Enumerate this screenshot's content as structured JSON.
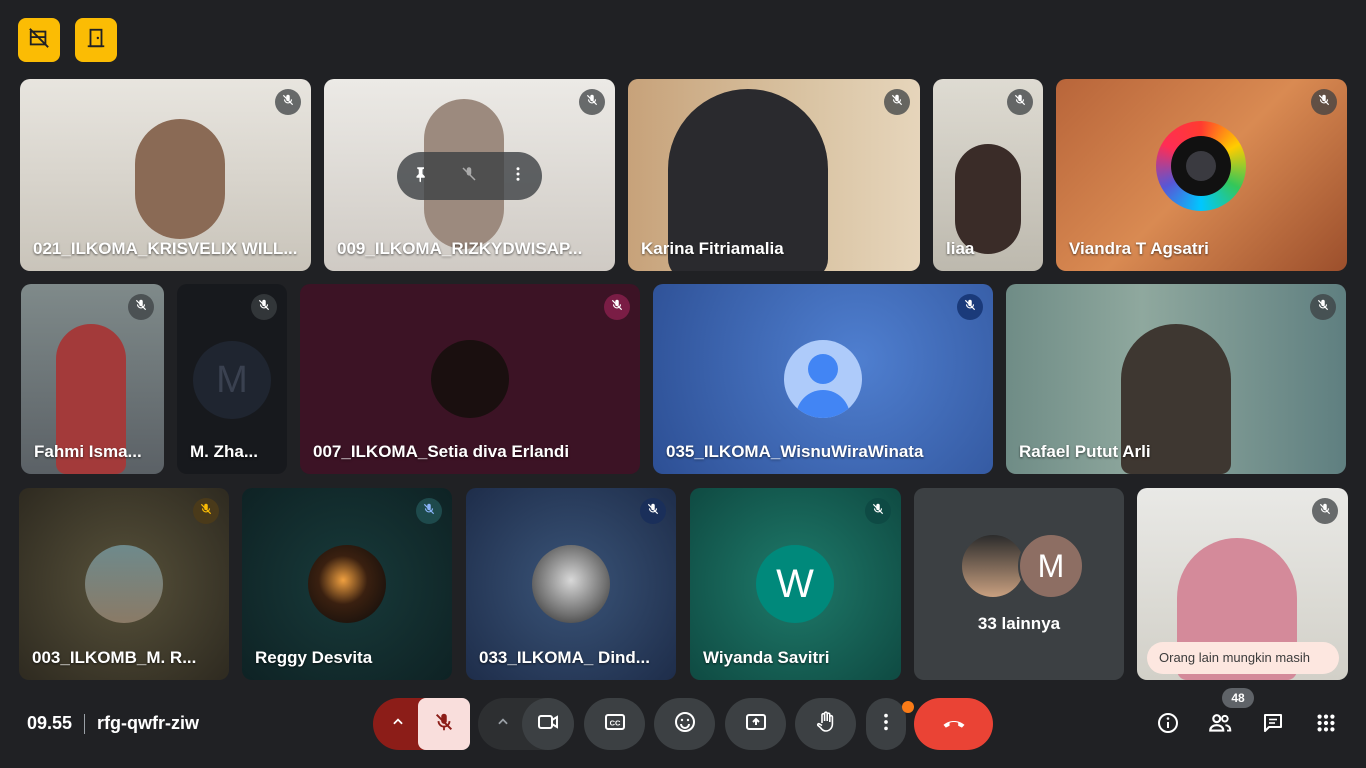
{
  "meeting": {
    "time": "09.55",
    "code": "rfg-qwfr-ziw",
    "participant_count": "48"
  },
  "participants": [
    {
      "name": "021_ILKOMA_KRISVELIX WILL..."
    },
    {
      "name": "009_ILKOMA_RIZKYDWISAP..."
    },
    {
      "name": "Karina Fitriamalia"
    },
    {
      "name": "liaa"
    },
    {
      "name": "Viandra T Agsatri"
    },
    {
      "name": "Fahmi Isma..."
    },
    {
      "name": "M. Zha...",
      "initial": "M"
    },
    {
      "name": "007_ILKOMA_Setia diva Erlandi"
    },
    {
      "name": "035_ILKOMA_WisnuWiraWinata"
    },
    {
      "name": "Rafael Putut Arli"
    },
    {
      "name": "003_ILKOMB_M. R..."
    },
    {
      "name": "Reggy Desvita"
    },
    {
      "name": "033_ILKOMA_ Dind..."
    },
    {
      "name": "Wiyanda Savitri",
      "initial": "W"
    }
  ],
  "others_tile": {
    "label": "33 lainnya",
    "initial": "M"
  },
  "toast": "Orang lain mungkin masih",
  "colors": {
    "background": "#202124",
    "accent_yellow": "#fbbc04",
    "end_call_red": "#ea4335",
    "mic_off_bg": "#f9dedc"
  },
  "icons": {
    "top_left": [
      "hide-tiles-icon",
      "door-exit-icon"
    ],
    "toolbar": [
      "chevron-up-icon",
      "mic-off-icon",
      "videocam-icon",
      "captions-icon",
      "emoji-icon",
      "present-screen-icon",
      "raise-hand-icon",
      "more-vert-icon",
      "call-end-icon"
    ],
    "right": [
      "info-icon",
      "people-icon",
      "chat-icon",
      "activities-icon"
    ]
  }
}
